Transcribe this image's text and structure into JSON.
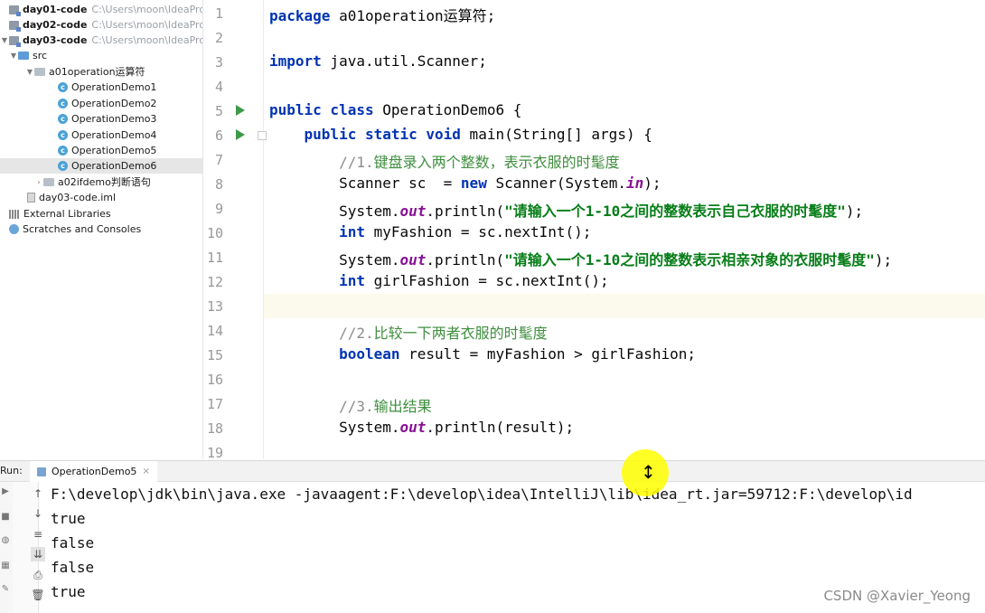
{
  "project_tree": {
    "modules": [
      {
        "name": "day01-code",
        "path": "C:\\Users\\moon\\IdeaProje"
      },
      {
        "name": "day02-code",
        "path": "C:\\Users\\moon\\IdeaProje"
      },
      {
        "name": "day03-code",
        "path": "C:\\Users\\moon\\IdeaProje"
      }
    ],
    "src": "src",
    "package1": "a01operation运算符",
    "classes": [
      "OperationDemo1",
      "OperationDemo2",
      "OperationDemo3",
      "OperationDemo4",
      "OperationDemo5",
      "OperationDemo6"
    ],
    "package2": "a02ifdemo判断语句",
    "iml": "day03-code.iml",
    "external_libraries": "External Libraries",
    "scratches": "Scratches and Consoles"
  },
  "editor": {
    "line_numbers": [
      "1",
      "2",
      "3",
      "4",
      "5",
      "6",
      "7",
      "8",
      "9",
      "10",
      "11",
      "12",
      "13",
      "14",
      "15",
      "16",
      "17",
      "18",
      "19"
    ],
    "code": {
      "l1_kw": "package",
      "l1_rest": " a01operation运算符;",
      "l3_kw": "import",
      "l3_rest": " java.util.Scanner;",
      "l5_kw": "public class",
      "l5_rest": " OperationDemo6 {",
      "l6_indent": "    ",
      "l6_kw": "public static void",
      "l6_rest": " main(String[] args) {",
      "l7_prefix": "        //1.",
      "l7_comment": "键盘录入两个整数，表示衣服的时髦度",
      "l8_a": "        Scanner sc  = ",
      "l8_kw": "new",
      "l8_b": " Scanner(System.",
      "l8_fld": "in",
      "l8_c": ");",
      "l9_a": "        System.",
      "l9_fld": "out",
      "l9_b": ".println(",
      "l9_str": "\"请输入一个1-10之间的整数表示自己衣服的时髦度\"",
      "l9_c": ");",
      "l10_indent": "        ",
      "l10_kw": "int",
      "l10_rest": " myFashion = sc.nextInt();",
      "l11_a": "        System.",
      "l11_fld": "out",
      "l11_b": ".println(",
      "l11_str": "\"请输入一个1-10之间的整数表示相亲对象的衣服时髦度\"",
      "l11_c": ");",
      "l12_indent": "        ",
      "l12_kw": "int",
      "l12_rest": " girlFashion = sc.nextInt();",
      "l14_prefix": "        //2.",
      "l14_comment": "比较一下两者衣服的时髦度",
      "l15_indent": "        ",
      "l15_kw": "boolean",
      "l15_rest": " result = myFashion > girlFashion;",
      "l17_prefix": "        //3.",
      "l17_comment": "输出结果",
      "l18_a": "        System.",
      "l18_fld": "out",
      "l18_b": ".println(result);"
    }
  },
  "run_panel": {
    "label": "Run:",
    "tab": "OperationDemo5",
    "tab_close": "×",
    "command": "F:\\develop\\jdk\\bin\\java.exe -javaagent:F:\\develop\\idea\\IntelliJ\\lib\\idea_rt.jar=59712:F:\\develop\\id",
    "output": [
      "true",
      "false",
      "false",
      "true"
    ]
  },
  "watermark": "CSDN @Xavier_Yeong"
}
